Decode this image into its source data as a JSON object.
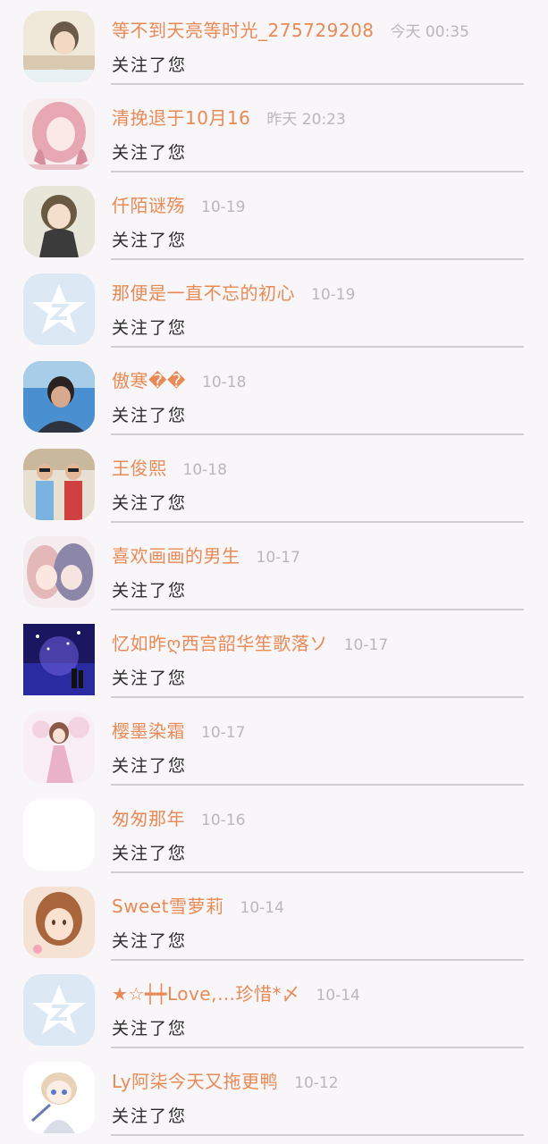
{
  "followers": [
    {
      "name": "等不到天亮等时光_275729208",
      "time": "今天 00:35",
      "action": "关注了您",
      "avatar": "girl-photo-avatar"
    },
    {
      "name": "清挽退于10月16",
      "time": "昨天 20:23",
      "action": "关注了您",
      "avatar": "anime-girl-pink-hair-avatar"
    },
    {
      "name": "仟陌谜殇",
      "time": "10-19",
      "action": "关注了您",
      "avatar": "anime-girl-avatar"
    },
    {
      "name": "那便是一直不忘的初心",
      "time": "10-19",
      "action": "关注了您",
      "avatar": "default-qq-star-avatar"
    },
    {
      "name": "傲寒��",
      "time": "10-18",
      "action": "关注了您",
      "avatar": "boy-photo-avatar"
    },
    {
      "name": "王俊熙",
      "time": "10-18",
      "action": "关注了您",
      "avatar": "two-boys-photo-avatar"
    },
    {
      "name": "喜欢画画的男生",
      "time": "10-17",
      "action": "关注了您",
      "avatar": "anime-couple-avatar"
    },
    {
      "name": "忆如昨ღ西宫韶华笙歌落ソ",
      "time": "10-17",
      "action": "关注了您",
      "avatar": "night-scene-avatar"
    },
    {
      "name": "樱墨染霜",
      "time": "10-17",
      "action": "关注了您",
      "avatar": "anime-girl-pink-dress-avatar"
    },
    {
      "name": "匆匆那年",
      "time": "10-16",
      "action": "关注了您",
      "avatar": "blank-white-avatar"
    },
    {
      "name": "Sweet雪萝莉",
      "time": "10-14",
      "action": "关注了您",
      "avatar": "anime-girl-brown-hair-avatar"
    },
    {
      "name": "★☆┿┿Love,…珍惜*〆",
      "time": "10-14",
      "action": "关注了您",
      "avatar": "default-qq-star-avatar"
    },
    {
      "name": "Ly阿柒今天又拖更鸭",
      "time": "10-12",
      "action": "关注了您",
      "avatar": "chibi-anime-avatar"
    }
  ]
}
